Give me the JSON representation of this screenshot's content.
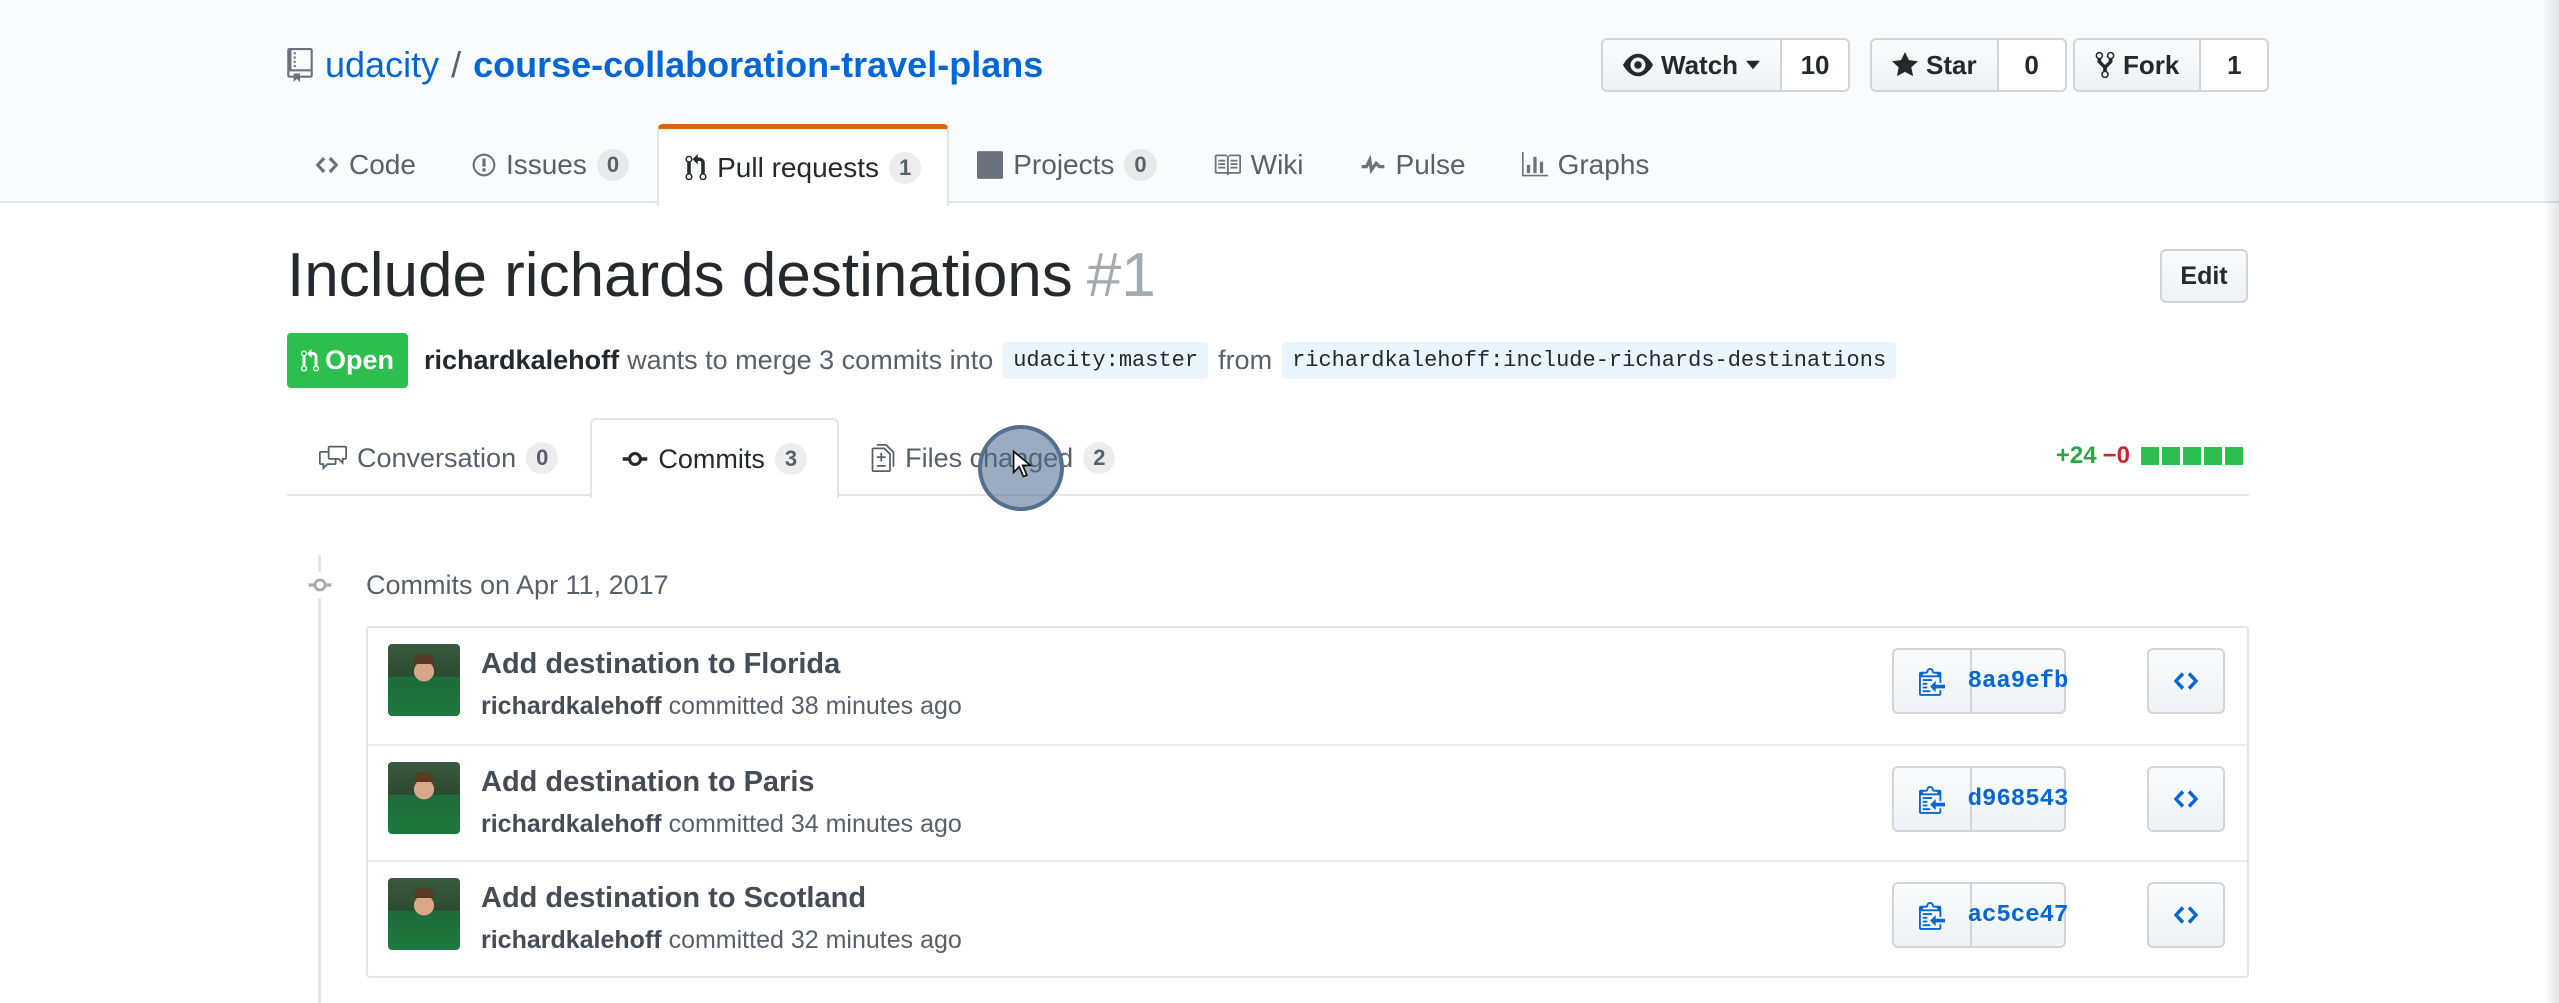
{
  "repo": {
    "owner": "udacity",
    "separator": "/",
    "name": "course-collaboration-travel-plans"
  },
  "actions": {
    "watch": {
      "label": "Watch",
      "count": "10"
    },
    "star": {
      "label": "Star",
      "count": "0"
    },
    "fork": {
      "label": "Fork",
      "count": "1"
    }
  },
  "reponav": [
    {
      "label": "Code",
      "icon": "code-icon",
      "counter": ""
    },
    {
      "label": "Issues",
      "icon": "issue-icon",
      "counter": "0"
    },
    {
      "label": "Pull requests",
      "icon": "pull-request-icon",
      "counter": "1",
      "selected": true
    },
    {
      "label": "Projects",
      "icon": "project-icon",
      "counter": "0"
    },
    {
      "label": "Wiki",
      "icon": "book-icon",
      "counter": ""
    },
    {
      "label": "Pulse",
      "icon": "pulse-icon",
      "counter": ""
    },
    {
      "label": "Graphs",
      "icon": "graph-icon",
      "counter": ""
    }
  ],
  "pr": {
    "title": "Include richards destinations",
    "number": "#1",
    "edit_label": "Edit",
    "state": "Open",
    "author": "richardkalehoff",
    "merge_text": "wants to merge 3 commits into",
    "base_branch": "udacity:master",
    "from_text": "from",
    "head_branch": "richardkalehoff:include-richards-destinations"
  },
  "tabs": {
    "conversation": {
      "label": "Conversation",
      "counter": "0"
    },
    "commits": {
      "label": "Commits",
      "counter": "3"
    },
    "files": {
      "label": "Files changed",
      "counter": "2"
    }
  },
  "diffstat": {
    "additions": "+24",
    "deletions": "−0",
    "blocks": 5
  },
  "commit_group": {
    "title": "Commits on Apr 11, 2017",
    "commits": [
      {
        "message": "Add destination to Florida",
        "author": "richardkalehoff",
        "action": "committed",
        "time": "38 minutes ago",
        "sha": "8aa9efb"
      },
      {
        "message": "Add destination to Paris",
        "author": "richardkalehoff",
        "action": "committed",
        "time": "34 minutes ago",
        "sha": "d968543"
      },
      {
        "message": "Add destination to Scotland",
        "author": "richardkalehoff",
        "action": "committed",
        "time": "32 minutes ago",
        "sha": "ac5ce47"
      }
    ]
  },
  "colors": {
    "link": "#0366d6",
    "open_state": "#2cbe4e",
    "selected_tab_accent": "#e36209",
    "additions": "#28a745",
    "deletions": "#cb2431"
  }
}
